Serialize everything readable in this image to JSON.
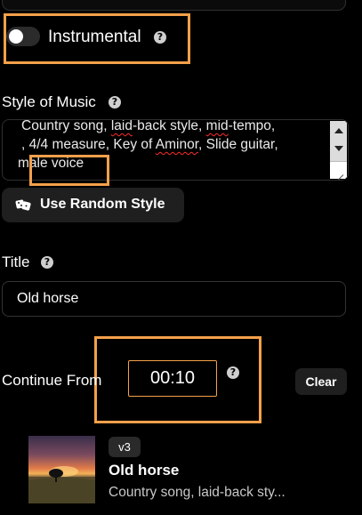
{
  "instrumental": {
    "label": "Instrumental",
    "enabled": false
  },
  "style_of_music": {
    "label": "Style of Music",
    "line1": "Country song, laid-back style, mid-tempo,",
    "line2": ", 4/4 measure, Key of Aminor, Slide guitar,",
    "line3": "male voice"
  },
  "random_style_button": {
    "label": "Use Random Style",
    "icon": "dice-icon"
  },
  "title_field": {
    "label": "Title",
    "value": "Old horse"
  },
  "continue_from": {
    "label": "Continue From",
    "value": "00:10",
    "clear_label": "Clear"
  },
  "song_card": {
    "version": "v3",
    "title": "Old horse",
    "description": "Country song, laid-back sty..."
  },
  "colors": {
    "highlight": "#f5a04a",
    "background": "#000000",
    "button": "#1f1f1f"
  }
}
